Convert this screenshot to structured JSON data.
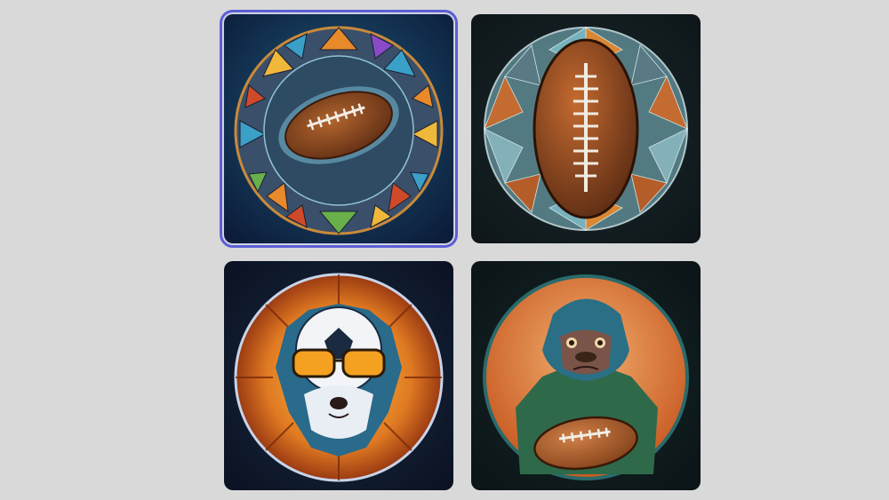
{
  "gallery": {
    "selected_index": 0,
    "images": [
      {
        "subject": "football-stained-glass-medallion",
        "selected": true
      },
      {
        "subject": "vertical-football-glass-orb",
        "selected": false
      },
      {
        "subject": "otter-with-sunglasses-soccer-helmet",
        "selected": false
      },
      {
        "subject": "gorilla-holding-football",
        "selected": false
      }
    ]
  },
  "colors": {
    "page_background": "#d9d9d9",
    "selection_outline": "#5b5fd6",
    "tile_dark_blue": "#0f2a4a",
    "tile_dark_teal": "#132128",
    "accent_orange": "#e8892a",
    "football_brown": "#8a4a22"
  }
}
